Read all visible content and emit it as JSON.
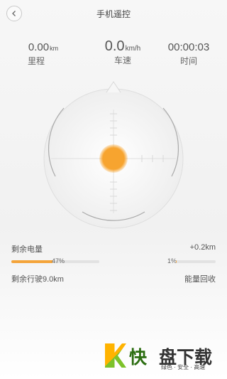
{
  "header": {
    "title": "手机遥控"
  },
  "stats": {
    "distance": {
      "value": "0.00",
      "unit": "km",
      "label": "里程"
    },
    "speed": {
      "value": "0.0",
      "unit": "km/h",
      "label": "车速"
    },
    "time": {
      "value": "00:00:03",
      "label": "时间"
    }
  },
  "battery": {
    "label": "剩余电量",
    "percent": "47%",
    "level": 0.47,
    "remaining_range": "剩余行驶9.0km"
  },
  "regen": {
    "value": "+0.2km",
    "percent": "1%",
    "level": 0.01,
    "label": "能量回收"
  },
  "colors": {
    "accent": "#f4a43a",
    "knob": "#f7a42f"
  },
  "watermark": {
    "brand1": "快",
    "brand2": "盘下载",
    "tagline": "绿色 · 安全 · 高速"
  }
}
